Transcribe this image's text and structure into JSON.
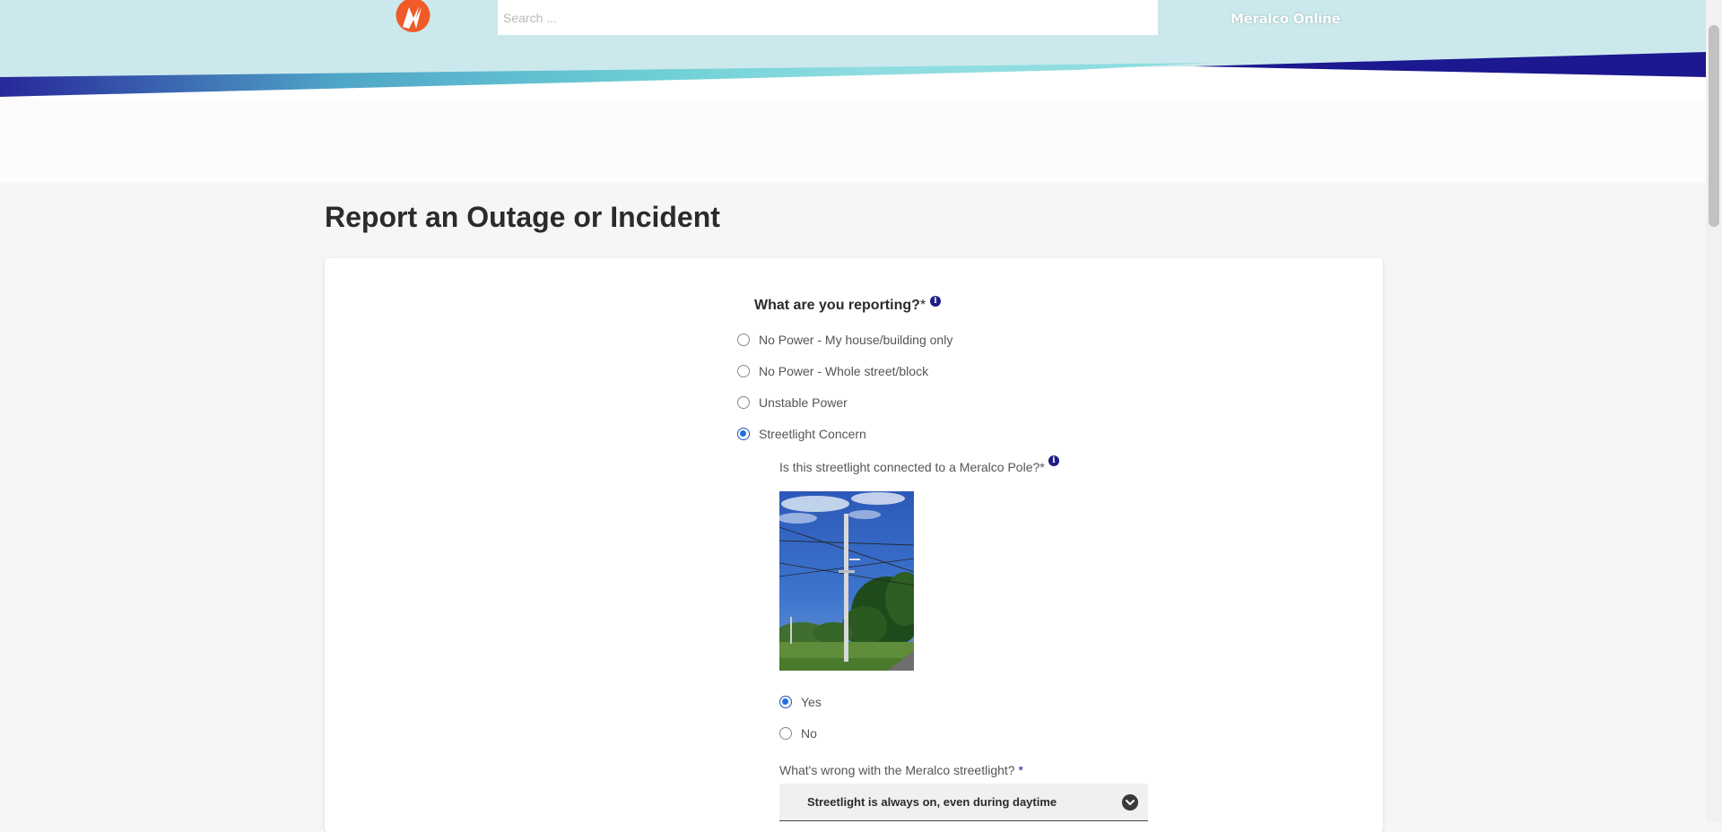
{
  "header": {
    "search_placeholder": "Search ...",
    "brand_link": "Meralco Online",
    "colors": {
      "band": "#cbe9ec",
      "navy": "#1f1c87",
      "teal": "#5fc4cf",
      "accent": "#f05a28"
    }
  },
  "page": {
    "title": "Report an Outage or Incident"
  },
  "form": {
    "question": "What are you reporting?",
    "required_mark": "*",
    "options": [
      {
        "label": "No Power - My house/building only",
        "checked": false
      },
      {
        "label": "No Power - Whole street/block",
        "checked": false
      },
      {
        "label": "Unstable Power",
        "checked": false
      },
      {
        "label": "Streetlight Concern",
        "checked": true
      }
    ],
    "streetlight": {
      "question": "Is this streetlight connected to a Meralco Pole?*",
      "answers": [
        {
          "label": "Yes",
          "checked": true
        },
        {
          "label": "No",
          "checked": false
        }
      ],
      "wrong_label": "What's wrong with the Meralco streetlight?",
      "wrong_required": "*",
      "selected_issue": "Streetlight is always on, even during daytime"
    }
  },
  "icons": {
    "info": "info-icon",
    "logo": "meralco-logo-icon",
    "dropdown": "chevron-down-icon"
  }
}
